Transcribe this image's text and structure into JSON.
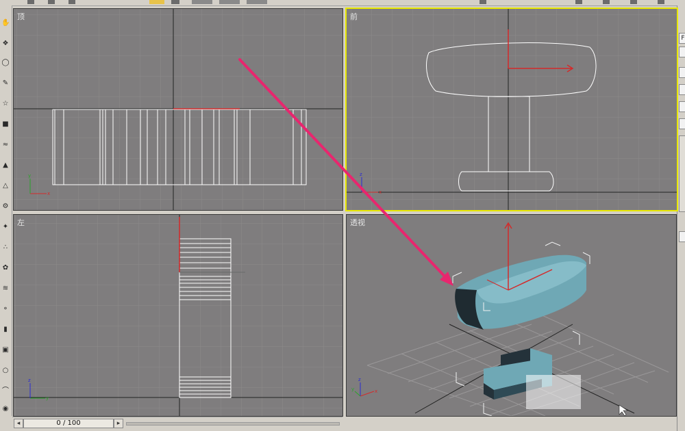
{
  "viewports": {
    "top": {
      "label": "顶"
    },
    "front": {
      "label": "前"
    },
    "left": {
      "label": "左"
    },
    "perspective": {
      "label": "透视"
    }
  },
  "timeline": {
    "frame_readout": "0 / 100",
    "prev_icon": "arrow-left-icon",
    "next_icon": "arrow-right-icon"
  },
  "colors": {
    "viewport_bg": "#7f7d7e",
    "grid": "#8c8a8b",
    "active_border": "#e8e800",
    "wire": "#ffffff",
    "model_fill": "#6fa8b5",
    "axis_red": "#d42a2a",
    "axis_green": "#2aa52a",
    "axis_blue": "#2a2ad4",
    "annotation_arrow": "#e8266e"
  },
  "axis_labels": {
    "x": "x",
    "y": "y",
    "z": "z"
  }
}
